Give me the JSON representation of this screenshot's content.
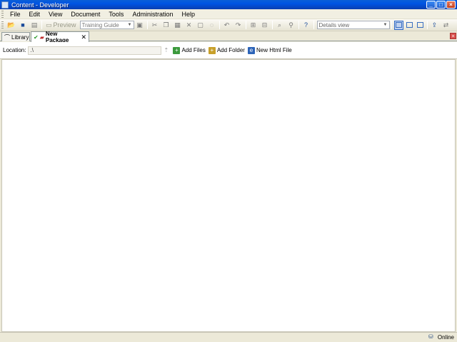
{
  "window": {
    "title": "Content - Developer",
    "controls": {
      "minimize": "_",
      "maximize": "□",
      "close": "×"
    }
  },
  "menu": {
    "items": [
      "File",
      "Edit",
      "View",
      "Document",
      "Tools",
      "Administration",
      "Help"
    ]
  },
  "toolbar": {
    "preview_label": "Preview",
    "guide_value": "Training Guide",
    "view_value": "Details view"
  },
  "tabs": {
    "library_label": "Library",
    "package_label": "New Package",
    "package_close": "✕"
  },
  "location": {
    "label": "Location:",
    "value": ".\\",
    "add_files": "Add Files",
    "add_folder": "Add Folder",
    "new_html_file": "New Html File"
  },
  "status": {
    "online": "Online"
  },
  "icons": {
    "app": "app-icon",
    "online": "network-icon"
  },
  "colors": {
    "titlebar": "#0054e3",
    "chrome": "#ece9d8",
    "selection": "#c1d2ee"
  }
}
